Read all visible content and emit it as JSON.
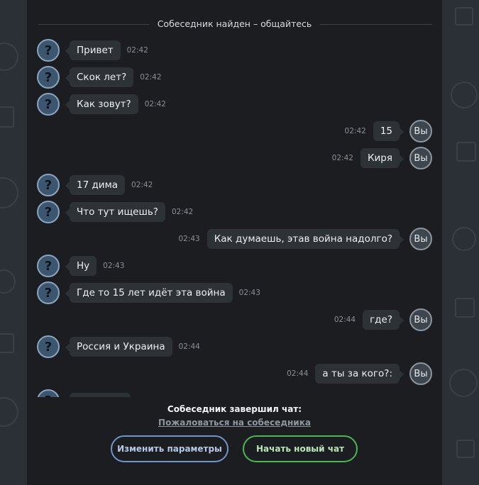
{
  "status": "Собеседник найден – общайтесь",
  "avatar_stranger": "?",
  "avatar_me": "Вы",
  "messages": [
    {
      "side": "in",
      "text": "Привет",
      "time": "02:42"
    },
    {
      "side": "in",
      "text": "Скок лет?",
      "time": "02:42"
    },
    {
      "side": "in",
      "text": "Как зовут?",
      "time": "02:42"
    },
    {
      "side": "out",
      "text": "15",
      "time": "02:42"
    },
    {
      "side": "out",
      "text": "Киря",
      "time": "02:42"
    },
    {
      "side": "in",
      "text": "17 дима",
      "time": "02:42"
    },
    {
      "side": "in",
      "text": "Что тут ищешь?",
      "time": "02:42"
    },
    {
      "side": "out",
      "text": "Как думаешь, этав война надолго?",
      "time": "02:43"
    },
    {
      "side": "in",
      "text": "Ну",
      "time": "02:43"
    },
    {
      "side": "in",
      "text": "Где то 15 лет идёт эта война",
      "time": "02:43"
    },
    {
      "side": "out",
      "text": "где?",
      "time": "02:44"
    },
    {
      "side": "in",
      "text": "Россия и Украина",
      "time": "02:44"
    },
    {
      "side": "out",
      "text": "а ты за кого?:",
      "time": "02:44"
    },
    {
      "side": "in",
      "text": "",
      "time": ""
    }
  ],
  "chat_ended": "Собеседник завершил чат:",
  "report_link": "Пожаловаться на собеседника",
  "buttons": {
    "change_params": "Изменить параметры",
    "new_chat": "Начать новый чат"
  },
  "colors": {
    "panel": "#1b1d20",
    "bubble": "#2d3237",
    "stranger_avatar": "#3c5670",
    "params_button": "#6f95c9",
    "new_chat_button": "#4bb84f"
  },
  "icons": {
    "stranger_avatar": "question-mark-icon",
    "my_avatar": "you-avatar-icon"
  }
}
